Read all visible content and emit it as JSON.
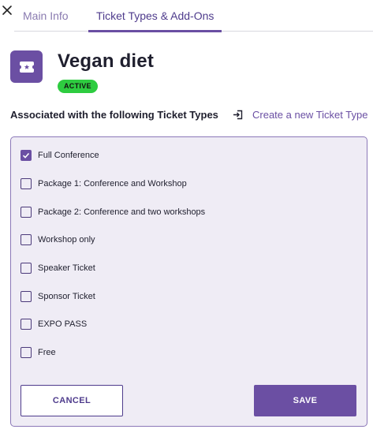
{
  "tabs": [
    {
      "label": "Main Info",
      "active": false
    },
    {
      "label": "Ticket Types & Add-Ons",
      "active": true
    }
  ],
  "header": {
    "title": "Vegan diet",
    "status": "ACTIVE",
    "icon": "ticket-icon"
  },
  "section": {
    "label": "Associated with the following Ticket Types",
    "create_link": "Create a new Ticket Type",
    "create_link_icon": "login-arrow-icon"
  },
  "ticket_types": [
    {
      "label": "Full Conference",
      "checked": true
    },
    {
      "label": "Package 1: Conference and Workshop",
      "checked": false
    },
    {
      "label": "Package 2: Conference and two workshops",
      "checked": false
    },
    {
      "label": "Workshop only",
      "checked": false
    },
    {
      "label": "Speaker Ticket",
      "checked": false
    },
    {
      "label": "Sponsor Ticket",
      "checked": false
    },
    {
      "label": "EXPO PASS",
      "checked": false
    },
    {
      "label": "Free",
      "checked": false
    }
  ],
  "actions": {
    "cancel_label": "CANCEL",
    "save_label": "SAVE"
  },
  "colors": {
    "accent": "#6b4fa3",
    "status_green": "#2ecc40",
    "panel_bg": "#efecf5"
  }
}
